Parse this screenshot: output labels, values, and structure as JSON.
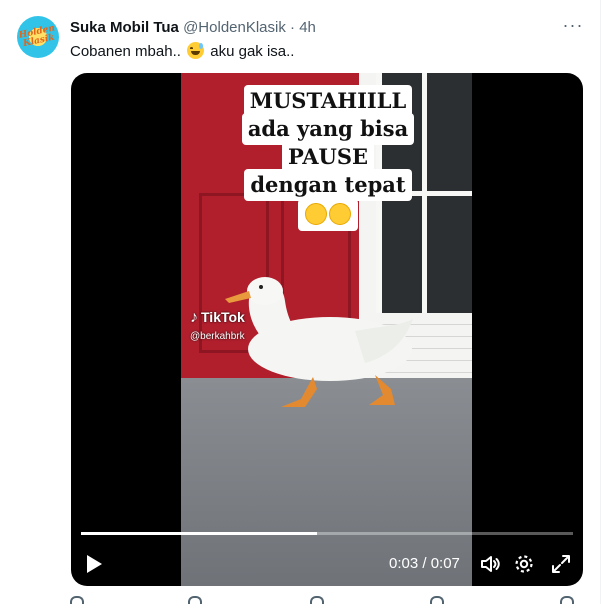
{
  "tweet": {
    "display_name": "Suka Mobil Tua",
    "handle": "@HoldenKlasik",
    "separator": "·",
    "time": "4h",
    "more_label": "···",
    "text_before_emoji": "Cobanen mbah..",
    "emoji_name": "grinning-face-with-sweat-emoji",
    "text_after_emoji": "aku gak isa..",
    "avatar_text": "Holden Klasik"
  },
  "video": {
    "caption_lines": [
      "MUSTAHIILL",
      "ada yang bisa",
      "PAUSE",
      "dengan tepat"
    ],
    "caption_emojis": [
      "grinning-squinting-face-emoji",
      "rolling-on-floor-laughing-emoji"
    ],
    "watermark_brand": "TikTok",
    "watermark_handle": "@berkahbrk",
    "current_time": "0:03",
    "duration": "0:07",
    "time_display": "0:03 / 0:07",
    "progress_fraction": 0.48
  },
  "colors": {
    "accent_text": "#0f1419",
    "secondary_text": "#536471",
    "video_bg": "#000000",
    "door_red": "#b11f2d"
  }
}
